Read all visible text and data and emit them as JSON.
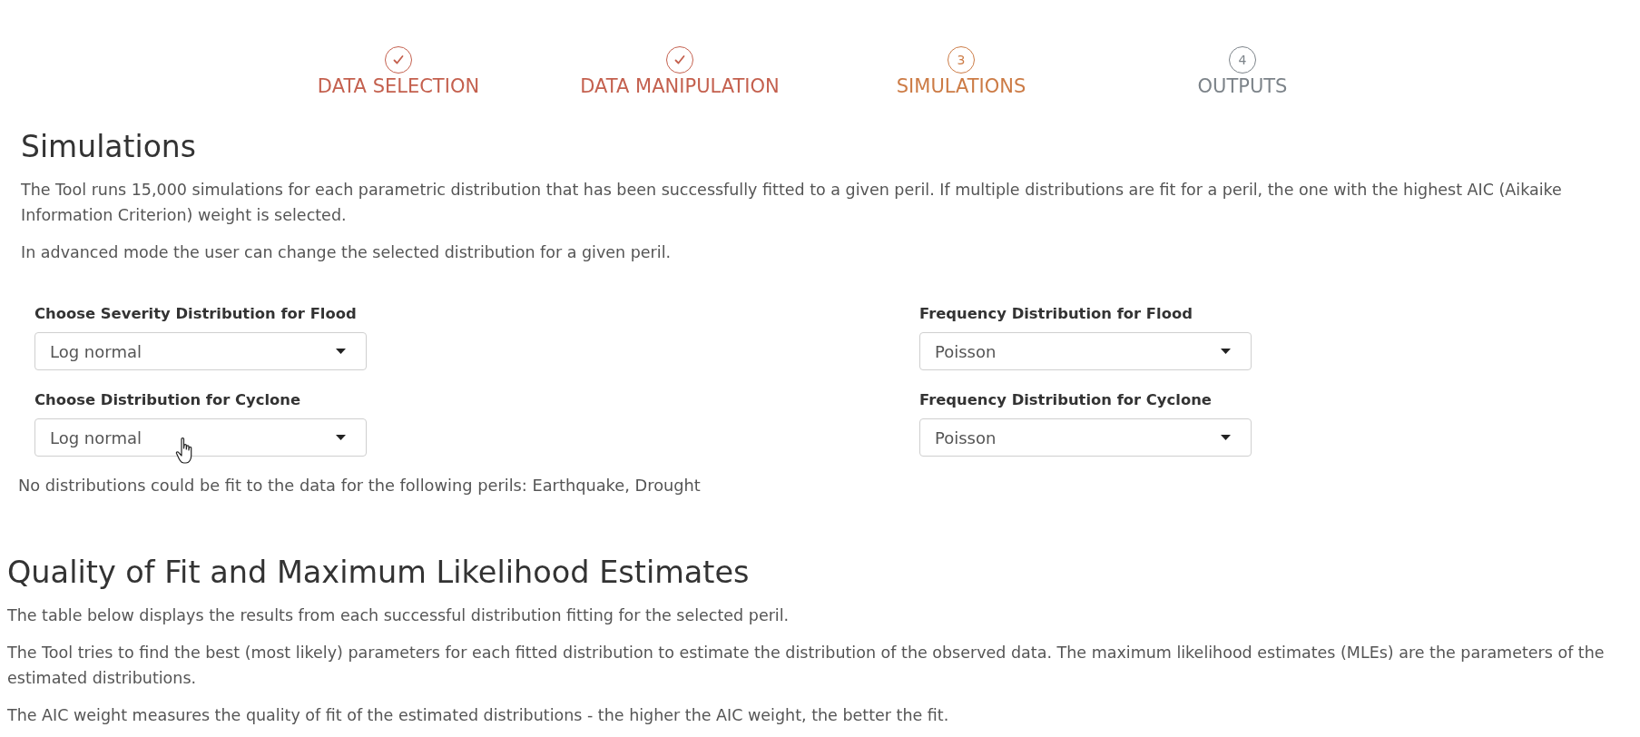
{
  "stepper": {
    "steps": [
      {
        "label": "DATA SELECTION",
        "kind": "done"
      },
      {
        "label": "DATA MANIPULATION",
        "kind": "done"
      },
      {
        "label": "SIMULATIONS",
        "number": "3",
        "kind": "current"
      },
      {
        "label": "OUTPUTS",
        "number": "4",
        "kind": "upcoming"
      }
    ]
  },
  "simulations": {
    "title": "Simulations",
    "paragraphs": [
      "The Tool runs 15,000 simulations for each parametric distribution that has been successfully fitted to a given peril. If multiple distributions are fit for a peril, the one with the highest AIC (Aikaike Information Criterion) weight is selected.",
      "In advanced mode the user can change the selected distribution for a given peril."
    ],
    "fields": [
      {
        "label": "Choose Severity Distribution for Flood",
        "value": "Log normal"
      },
      {
        "label": "Frequency Distribution for Flood",
        "value": "Poisson"
      },
      {
        "label": "Choose Distribution for Cyclone",
        "value": "Log normal"
      },
      {
        "label": "Frequency Distribution for Cyclone",
        "value": "Poisson"
      }
    ],
    "note": "No distributions could be fit to the data for the following perils: Earthquake, Drought"
  },
  "quality_of_fit": {
    "title": "Quality of Fit and Maximum Likelihood Estimates",
    "paragraphs": [
      "The table below displays the results from each successful distribution fitting for the selected peril.",
      "The Tool tries to find the best (most likely) parameters for each fitted distribution to estimate the distribution of the observed data. The maximum likelihood estimates (MLEs) are the parameters of the estimated distributions.",
      "The AIC weight measures the quality of fit of the estimated distributions - the higher the AIC weight, the better the fit."
    ]
  }
}
